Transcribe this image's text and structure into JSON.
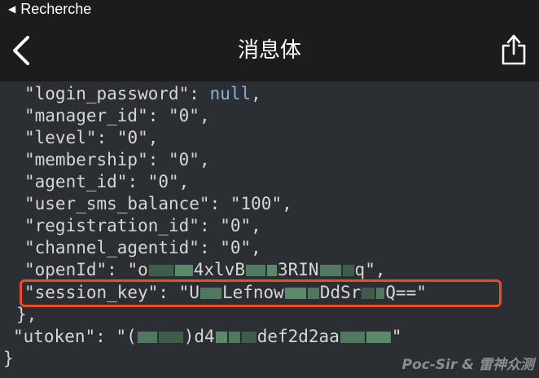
{
  "status_bar": {
    "back_app_label": "Recherche"
  },
  "nav": {
    "title": "消息体",
    "back_icon": "chevron-left-icon",
    "share_icon": "share-icon"
  },
  "json_lines": [
    {
      "key": "\"login_password\"",
      "sep": ": ",
      "value": "null",
      "value_kind": "kw",
      "tail": ","
    },
    {
      "key": "\"manager_id\"",
      "sep": ": ",
      "value": "\"0\"",
      "value_kind": "str",
      "tail": ","
    },
    {
      "key": "\"level\"",
      "sep": ": ",
      "value": "\"0\"",
      "value_kind": "str",
      "tail": ","
    },
    {
      "key": "\"membership\"",
      "sep": ": ",
      "value": "\"0\"",
      "value_kind": "str",
      "tail": ","
    },
    {
      "key": "\"agent_id\"",
      "sep": ": ",
      "value": "\"0\"",
      "value_kind": "str",
      "tail": ","
    },
    {
      "key": "\"user_sms_balance\"",
      "sep": ": ",
      "value": "\"100\"",
      "value_kind": "str",
      "tail": ","
    },
    {
      "key": "\"registration_id\"",
      "sep": ": ",
      "value": "\"0\"",
      "value_kind": "str",
      "tail": ","
    },
    {
      "key": "\"channel_agentid\"",
      "sep": ": ",
      "value": "\"0\"",
      "value_kind": "str",
      "tail": ","
    }
  ],
  "openid": {
    "key": "\"openId\"",
    "sep": ": ",
    "v1": "\"o",
    "v2": "4xlvB",
    "v3": "3RIN",
    "v4": "q\"",
    "tail": ","
  },
  "session_key": {
    "key": "\"session_key\"",
    "sep": ": ",
    "v1": "\"U",
    "v2": "Lefnow",
    "v3": "DdSr",
    "v4": "Q==\""
  },
  "close_inner": "},",
  "utoken": {
    "key": "\"utoken\"",
    "sep": ": ",
    "v1": "\"(",
    "v2": ")d4",
    "v3": "def2d2aa",
    "v4": "\""
  },
  "close_outer": "}",
  "watermark": "Poc-Sir & 雷神众测",
  "colors": {
    "background": "#2b2f33",
    "bar": "#1c1c1e",
    "highlight": "#f04b1e",
    "null_keyword": "#7fb3d8",
    "mosaic": "#4f7a60"
  }
}
